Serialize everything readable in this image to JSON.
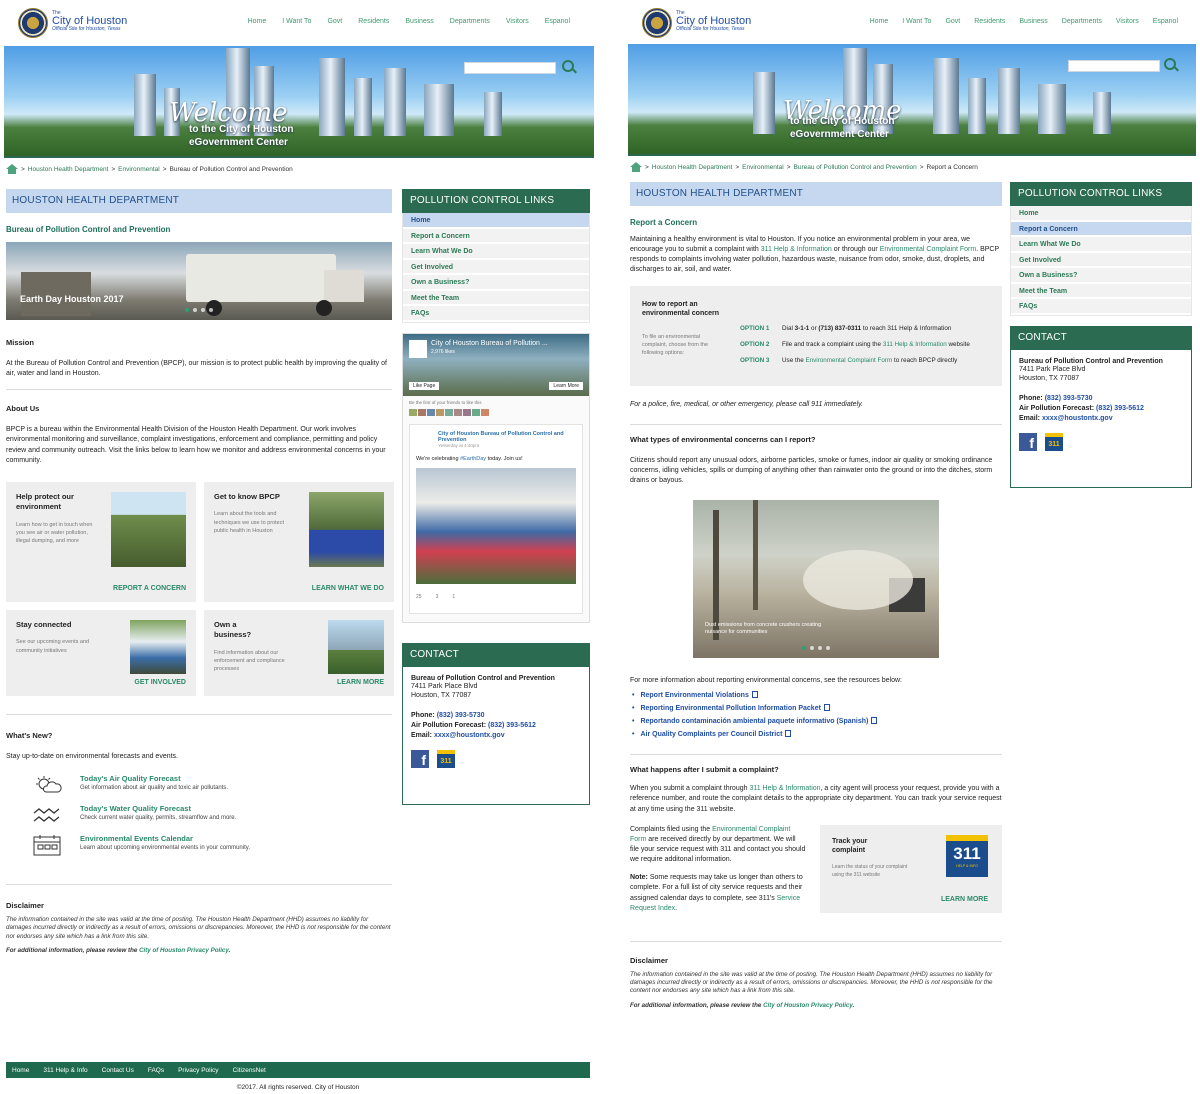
{
  "site": {
    "logo_the": "The",
    "logo_city": "City of Houston",
    "logo_sub": "Official Site for Houston, Texas"
  },
  "nav": [
    "Home",
    "I Want To",
    "Govt",
    "Residents",
    "Business",
    "Departments",
    "Visitors",
    "Espanol"
  ],
  "hero": {
    "welcome": "Welcome",
    "line1": "to the City of Houston",
    "line2": "eGovernment Center"
  },
  "left": {
    "breadcrumb": {
      "a": "Houston Health Department",
      "b": "Environmental",
      "c": "Bureau of Pollution Control and Prevention"
    },
    "band": "HOUSTON HEALTH DEPARTMENT",
    "bureau": "Bureau of Pollution Control and Prevention",
    "slide_caption": "Earth Day Houston 2017",
    "mission_h": "Mission",
    "mission_p": "At the Bureau of Pollution Control and Prevention (BPCP), our mission is to protect public health by improving the quality of air, water and land in Houston.",
    "about_h": "About Us",
    "about_p": "BPCP is a bureau within the Environmental Health Division of the Houston Health Department. Our work involves environmental monitoring and surveillance, complaint investigations, enforcement and compliance, permitting and policy review and community outreach. Visit the links below to learn how we monitor and address environmental concerns in your community.",
    "cards": [
      {
        "title": "Help protect our environment",
        "desc": "Learn how to get in touch when you see air or water pollution, illegal dumping, and more",
        "cta": "REPORT A CONCERN"
      },
      {
        "title": "Get to know BPCP",
        "desc": "Learn about the tools and techniques we use to protect public health in Houston",
        "cta": "LEARN WHAT WE DO"
      },
      {
        "title": "Stay connected",
        "desc": "See our upcoming events and community initiatives",
        "cta": "GET INVOLVED"
      },
      {
        "title": "Own a business?",
        "desc": "Find information about our enforcement and compliance processes",
        "cta": "LEARN MORE"
      }
    ],
    "whatsnew_h": "What's New?",
    "whatsnew_p": "Stay up-to-date on environmental forecasts and events.",
    "feeds": [
      {
        "title": "Today's Air Quality Forecast",
        "desc": "Get information about air quality and toxic air pollutants.",
        "icon": "sun-cloud-icon"
      },
      {
        "title": "Today's Water Quality Forecast",
        "desc": "Check current water quality, permits, streamflow and more.",
        "icon": "water-waves-icon"
      },
      {
        "title": "Environmental Events Calendar",
        "desc": "Learn about upcoming environmental events in your community.",
        "icon": "calendar-icon"
      }
    ],
    "disclaimer_h": "Disclaimer",
    "disclaimer_p": "The information contained in the site was valid at the time of posting. The Houston Health Department (HHD) assumes no liability for damages incurred directly or indirectly as a result of errors, omissions or discrepancies. Moreover, the HHD is not responsible for the content nor endorses any site which has a link from this site.",
    "privacy_pre": "For additional information, please review the ",
    "privacy_link": "City of Houston Privacy Policy",
    "privacy_post": ".",
    "footer_links": [
      "Home",
      "311 Help & Info",
      "Contact Us",
      "FAQs",
      "Privacy Policy",
      "CitizensNet"
    ],
    "copyright": "©2017. All rights reserved. City of Houston"
  },
  "sidebar": {
    "links_head": "POLLUTION CONTROL LINKS",
    "links": [
      "Home",
      "Report a Concern",
      "Learn What We Do",
      "Get Involved",
      "Own a Business?",
      "Meet the Team",
      "FAQs"
    ],
    "fb": {
      "page": "City of Houston Bureau of Pollution ...",
      "likes": "2,976 likes",
      "like_btn": "Like Page",
      "learn_btn": "Learn More",
      "friends": "Be the first of your friends to like this",
      "post_author": "City of Houston Bureau of Pollution Control and Prevention",
      "post_time": "Yesterday at 4:40pm",
      "post_text_pre": "We're celebrating ",
      "post_tag": "#EarthDay",
      "post_text_post": " today. Join us!",
      "likes_count": "25",
      "comments": "3",
      "shares": "1"
    },
    "contact_head": "CONTACT",
    "contact_org": "Bureau of Pollution Control and Prevention",
    "contact_addr1": "7411 Park Place Blvd",
    "contact_addr2": "Houston, TX 77087",
    "phone_label": "Phone:",
    "phone": "(832) 393-5730",
    "fax_label": "Air Pollution Forecast:",
    "fax": "(832) 393-5612",
    "email_label": "Email:",
    "email": "xxxx@houstontx.gov",
    "icon311": "311"
  },
  "right": {
    "breadcrumb": {
      "a": "Houston Health Department",
      "b": "Environmental",
      "c": "Bureau of Pollution Control and Prevention",
      "d": "Report a Concern"
    },
    "band": "HOUSTON HEALTH DEPARTMENT",
    "title": "Report a Concern",
    "intro_1": "Maintaining a healthy environment is vital to Houston. If you notice an environmental problem in your area, we encourage you to submit a complaint with ",
    "intro_link1": "311 Help & Information",
    "intro_2": " or through our ",
    "intro_link2": "Environmental Complaint Form",
    "intro_3": ". BPCP responds to complaints involving water pollution, hazardous waste, nuisance from odor, smoke, dust, droplets, and discharges to air, soil, and water.",
    "how_title": "How to report an environmental concern",
    "how_desc": "To file an environmental complaint, choose from the following options:",
    "options": [
      {
        "label": "OPTION 1",
        "text_pre": "Dial ",
        "bold": "3-1-1",
        "mid": " or ",
        "bold2": "(713) 837-0311",
        "text_post": " to reach 311 Help & Information",
        "link": ""
      },
      {
        "label": "OPTION 2",
        "text_pre": "File and track a complaint using the ",
        "link": "311 Help & Information",
        "text_post": " website"
      },
      {
        "label": "OPTION 3",
        "text_pre": "Use the ",
        "link": "Environmental Complaint Form",
        "text_post": " to reach BPCP directly"
      }
    ],
    "emergency": "For a police, fire, medical, or other emergency, please call 911 immediately.",
    "types_h": "What types of environmental concerns can I report?",
    "types_p": "Citizens should report any unusual odors, airborne particles, smoke or fumes, indoor air quality or smoking ordinance concerns, idling vehicles, spills or dumping of anything other than rainwater onto the ground or into the ditches, storm drains or bayous.",
    "photo_caption": "Dust emissions from concrete crushers creating nuisance for communities",
    "resources_intro": "For more information about reporting environmental concerns, see the resources below:",
    "resources": [
      "Report Environmental Violations",
      "Reporting Environmental Pollution Information Packet",
      "Reportando contaminación ambiental paquete informativo (Spanish)",
      "Air Quality Complaints per Council District"
    ],
    "after_h": "What happens after I submit a complaint?",
    "after_1": "When you submit a complaint through ",
    "after_link": "311 Help & Information",
    "after_2": ", a city agent will process your request, provide you with a reference number, and route the complaint details to the appropriate city department. You can track your service request at any time using the 311 website.",
    "filed_1": "Complaints filed using the ",
    "filed_link": "Environmental Complaint Form",
    "filed_2": " are received directly by our department. We will file your service request with 311 and contact you should we require additonal information.",
    "note_label": "Note:",
    "note_1": " Some requests may take us longer than others to complete. For a full list of city service requests and their assigned calendar days to complete, see 311's ",
    "note_link": "Service Request Index",
    "note_2": ".",
    "track_title": "Track your complaint",
    "track_desc": "Learn the status of your complaint using the 311 website",
    "track_cta": "LEARN MORE",
    "badge_top": "CITY OF HOUSTON",
    "badge_num": "311",
    "badge_bottom": "HELP & INFO"
  },
  "colors": {
    "green": "#2b6b52",
    "link": "#2a8a68",
    "band": "#c6d8ef",
    "blue": "#1f4ea3"
  }
}
